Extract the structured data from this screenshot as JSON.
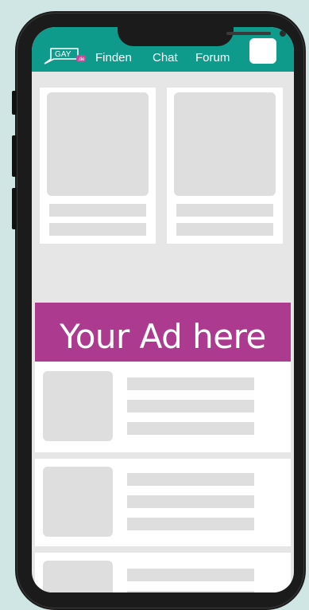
{
  "app": {
    "logo_text": "GAY",
    "logo_badge": ".de"
  },
  "nav": {
    "items": [
      "Finden",
      "Chat",
      "Forum"
    ]
  },
  "ad": {
    "text": "Your Ad here"
  },
  "colors": {
    "topbar": "#0e9b8c",
    "ad_background": "#ac3a8e",
    "placeholder": "#dedede",
    "page_background": "#cfe6e4"
  }
}
